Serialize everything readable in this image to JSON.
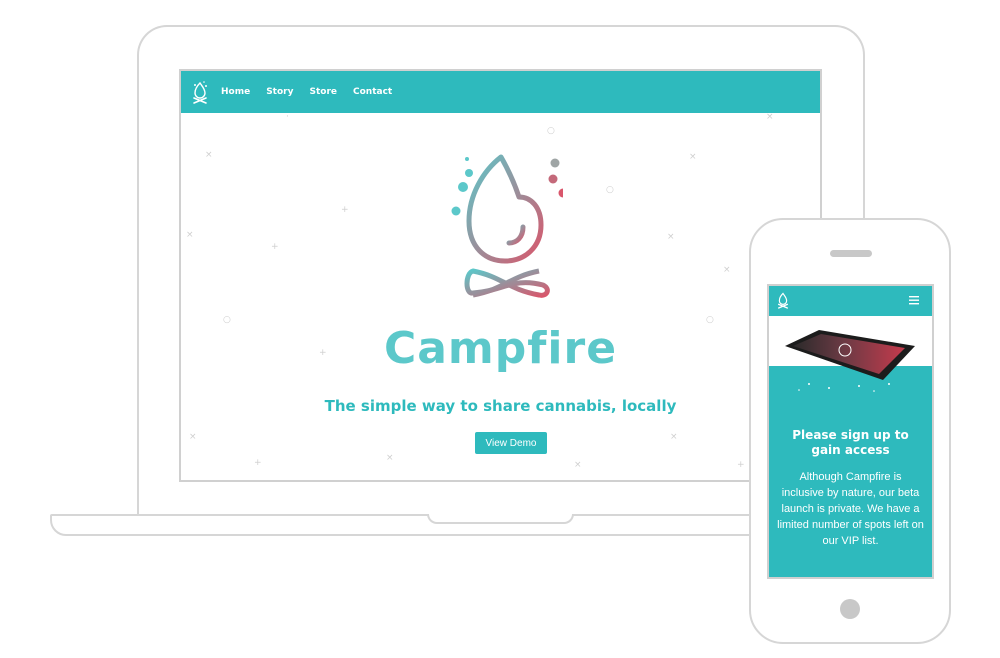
{
  "desktop": {
    "nav": {
      "links": [
        "Home",
        "Story",
        "Store",
        "Contact"
      ]
    },
    "hero": {
      "title": "Campfire",
      "subtitle": "The simple way to share cannabis, locally",
      "cta_label": "View Demo"
    }
  },
  "mobile": {
    "menu_icon": "hamburger-icon",
    "signup_title": "Please sign up to gain access",
    "signup_body": "Although Campfire is inclusive by nature, our beta launch is private. We have a limited number of spots left on our VIP list."
  },
  "colors": {
    "teal": "#2ebabd",
    "logo_teal": "#5cc8ca",
    "logo_rose": "#d9566b",
    "device_outline": "#d6d6d6"
  }
}
